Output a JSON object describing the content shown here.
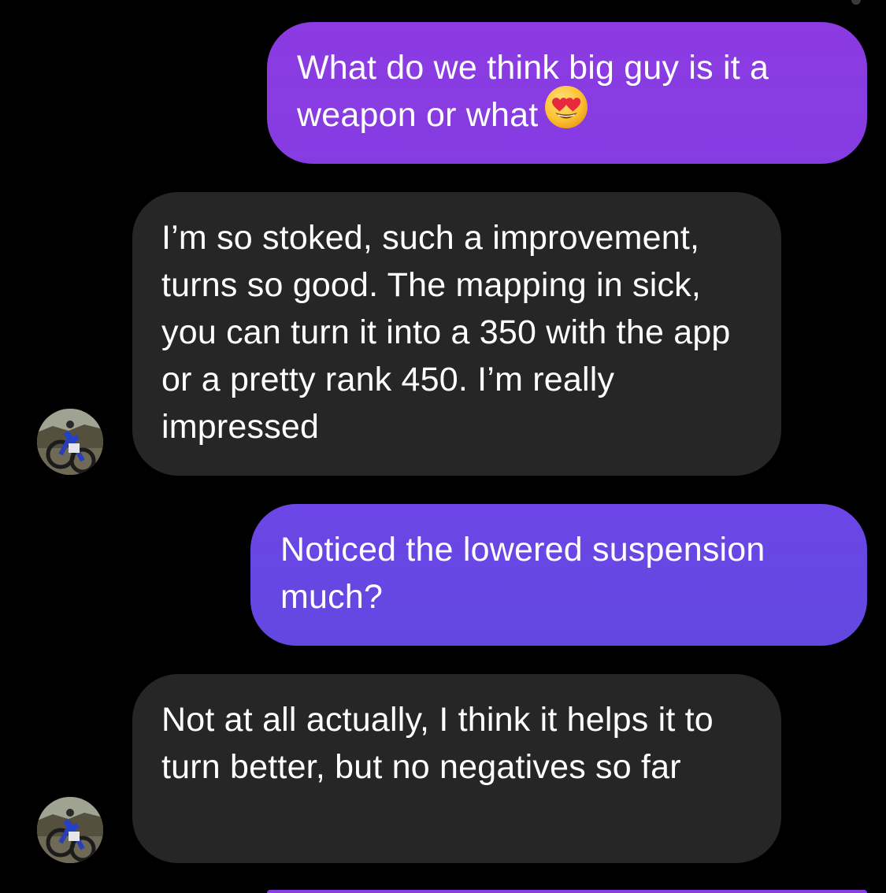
{
  "colors": {
    "background": "#000000",
    "incoming_bubble": "#262626",
    "outgoing_gradient_top": "#8c3ae2",
    "outgoing_gradient_bottom": "#6247e0",
    "text": "#ffffff"
  },
  "messages": [
    {
      "direction": "outgoing",
      "text": "What do we think big guy is it a weapon or what",
      "emoji": "heart-eyes-emoji"
    },
    {
      "direction": "incoming",
      "text": "I’m so stoked, such a improvement, turns so good. The mapping in sick, you can turn it into a 350 with the app or a pretty rank 450. I’m really impressed",
      "avatar": "dirt-bike-avatar"
    },
    {
      "direction": "outgoing",
      "text": "Noticed the lowered suspension much?"
    },
    {
      "direction": "incoming",
      "text": "Not at all actually, I think it helps it to turn better, but no negatives so far",
      "avatar": "dirt-bike-avatar"
    }
  ]
}
